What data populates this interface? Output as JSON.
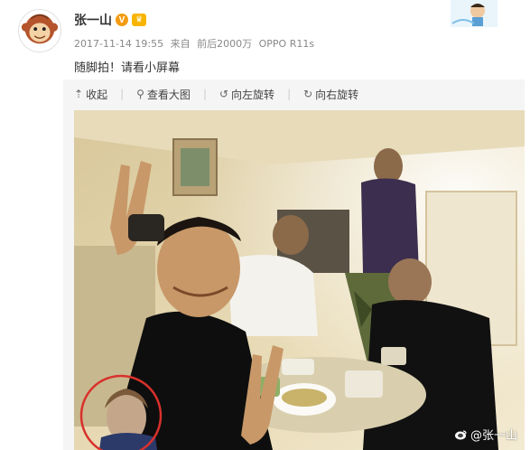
{
  "user": {
    "name": "张一山",
    "verified_mark": "V"
  },
  "post": {
    "timestamp": "2017-11-14 19:55",
    "source_prefix": "来自",
    "views": "前后2000万",
    "device": "OPPO R11s",
    "text": "随脚拍！请看小屏幕"
  },
  "toolbar": {
    "collapse": "收起",
    "view_large": "查看大图",
    "rotate_left": "向左旋转",
    "rotate_right": "向右旋转"
  },
  "photo": {
    "watermark": "@张一山"
  },
  "colors": {
    "highlight_circle": "#d9312b",
    "verified": "#f39c12"
  }
}
